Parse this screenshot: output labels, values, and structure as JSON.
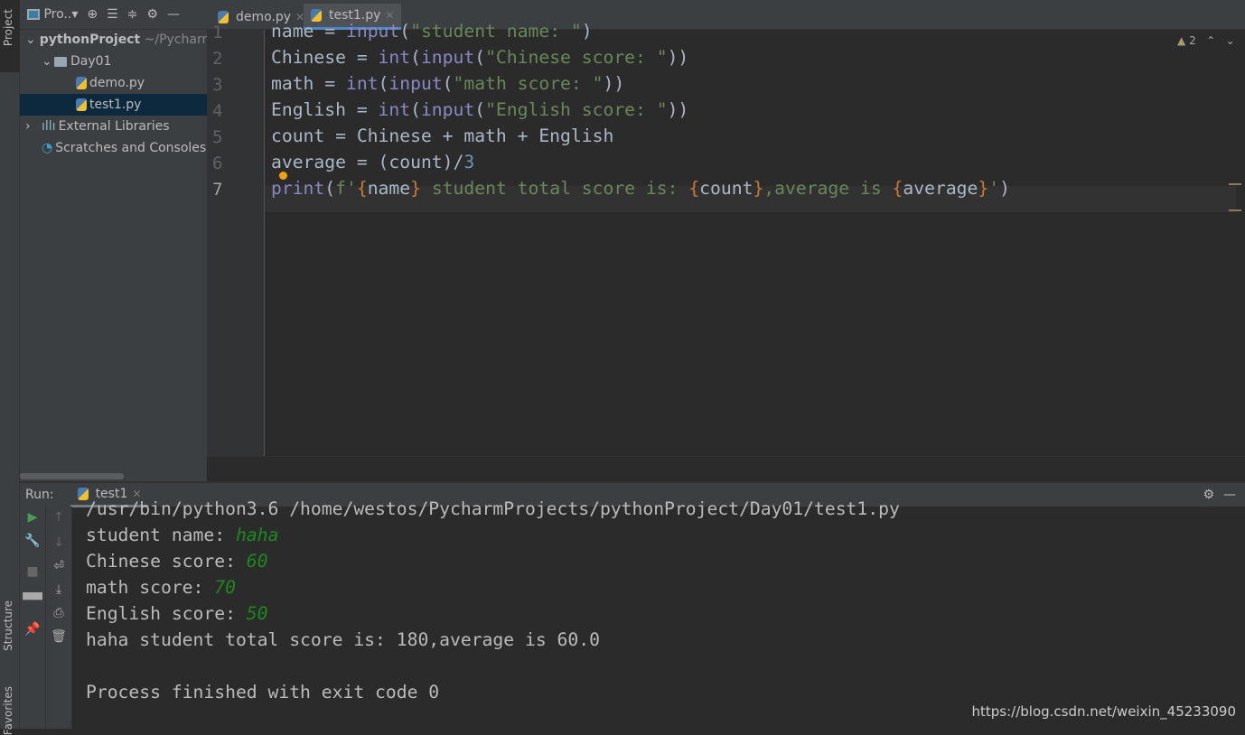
{
  "left_stripe": {
    "project": "Project",
    "structure": "Structure",
    "favorites": "Favorites"
  },
  "project_panel": {
    "title": "Pro..",
    "tree": [
      {
        "label": "pythonProject",
        "hint": "~/PycharmProjects",
        "type": "folder",
        "expanded": true
      },
      {
        "label": "Day01",
        "type": "folder",
        "expanded": true
      },
      {
        "label": "demo.py",
        "type": "python"
      },
      {
        "label": "test1.py",
        "type": "python",
        "selected": true
      },
      {
        "label": "External Libraries",
        "type": "libraries"
      },
      {
        "label": "Scratches and Consoles",
        "type": "scratches"
      }
    ]
  },
  "editor": {
    "tabs": [
      {
        "label": "demo.py"
      },
      {
        "label": "test1.py",
        "active": true
      }
    ],
    "warnings": "2",
    "lines": [
      [
        [
          "name = ",
          "d"
        ],
        [
          "input",
          "b"
        ],
        [
          "(",
          "d"
        ],
        [
          "\"student name: \"",
          "s"
        ],
        [
          ")",
          "d"
        ]
      ],
      [
        [
          "Chinese = ",
          "d"
        ],
        [
          "int",
          "b"
        ],
        [
          "(",
          "d"
        ],
        [
          "input",
          "b"
        ],
        [
          "(",
          "d"
        ],
        [
          "\"Chinese score: \"",
          "s"
        ],
        [
          "))",
          "d"
        ]
      ],
      [
        [
          "math = ",
          "d"
        ],
        [
          "int",
          "b"
        ],
        [
          "(",
          "d"
        ],
        [
          "input",
          "b"
        ],
        [
          "(",
          "d"
        ],
        [
          "\"math score: \"",
          "s"
        ],
        [
          "))",
          "d"
        ]
      ],
      [
        [
          "English = ",
          "d"
        ],
        [
          "int",
          "b"
        ],
        [
          "(",
          "d"
        ],
        [
          "input",
          "b"
        ],
        [
          "(",
          "d"
        ],
        [
          "\"English score: \"",
          "s"
        ],
        [
          "))",
          "d"
        ]
      ],
      [
        [
          "count = Chinese + math + English",
          "d"
        ]
      ],
      [
        [
          "average = (count)/",
          "d"
        ],
        [
          "3",
          "n"
        ]
      ],
      [
        [
          "print",
          "b"
        ],
        [
          "(",
          "d"
        ],
        [
          "f'",
          "s"
        ],
        [
          "{",
          "o"
        ],
        [
          "name",
          "d"
        ],
        [
          "}",
          "o"
        ],
        [
          " student total score is: ",
          "s"
        ],
        [
          "{",
          "o"
        ],
        [
          "count",
          "d"
        ],
        [
          "}",
          "o"
        ],
        [
          ",average is ",
          "s"
        ],
        [
          "{",
          "o"
        ],
        [
          "average",
          "d"
        ],
        [
          "}",
          "o"
        ],
        [
          "'",
          "s"
        ],
        [
          ")",
          "d"
        ]
      ]
    ]
  },
  "run": {
    "label": "Run:",
    "tab": "test1",
    "output": [
      {
        "text": "/usr/bin/python3.6 /home/westos/PycharmProjects/pythonProject/Day01/test1.py"
      },
      {
        "text": "student name: ",
        "input": "haha"
      },
      {
        "text": "Chinese score: ",
        "input": "60"
      },
      {
        "text": "math score: ",
        "input": "70"
      },
      {
        "text": "English score: ",
        "input": "50"
      },
      {
        "text": "haha student total score is: 180,average is 60.0"
      },
      {
        "text": ""
      },
      {
        "text": "Process finished with exit code 0"
      }
    ]
  },
  "watermark": "https://blog.csdn.net/weixin_45233090",
  "colors": {
    "d": "#a9b7c6",
    "b": "#8888c6",
    "s": "#6a8759",
    "o": "#cc7832",
    "n": "#6897bb"
  }
}
